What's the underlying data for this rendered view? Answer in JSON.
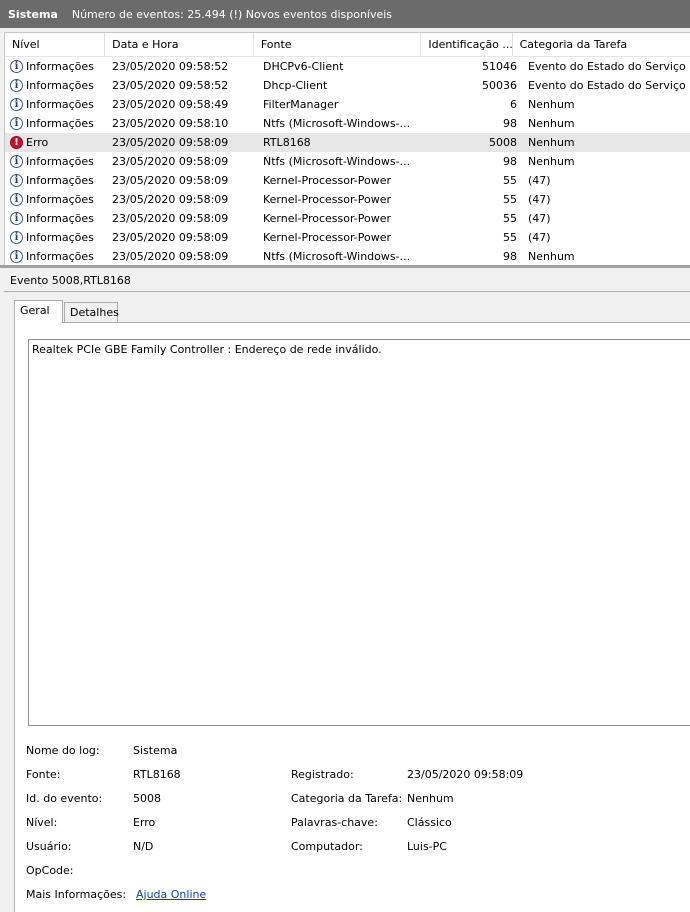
{
  "header": {
    "log_name": "Sistema",
    "summary": "Número de eventos: 25.494 (!) Novos eventos disponíveis"
  },
  "grid": {
    "columns": [
      "Nível",
      "Data e Hora",
      "Fonte",
      "Identificação ...",
      "Categoria da Tarefa"
    ],
    "rows": [
      {
        "level": "Informações",
        "icon": "info-icon",
        "datetime": "23/05/2020 09:58:52",
        "source": "DHCPv6-Client",
        "id": "51046",
        "category": "Evento do Estado do Serviço"
      },
      {
        "level": "Informações",
        "icon": "info-icon",
        "datetime": "23/05/2020 09:58:52",
        "source": "Dhcp-Client",
        "id": "50036",
        "category": "Evento do Estado do Serviço"
      },
      {
        "level": "Informações",
        "icon": "info-icon",
        "datetime": "23/05/2020 09:58:49",
        "source": "FilterManager",
        "id": "6",
        "category": "Nenhum"
      },
      {
        "level": "Informações",
        "icon": "info-icon",
        "datetime": "23/05/2020 09:58:10",
        "source": "Ntfs (Microsoft-Windows-...",
        "id": "98",
        "category": "Nenhum"
      },
      {
        "level": "Erro",
        "icon": "error-icon",
        "datetime": "23/05/2020 09:58:09",
        "source": "RTL8168",
        "id": "5008",
        "category": "Nenhum"
      },
      {
        "level": "Informações",
        "icon": "info-icon",
        "datetime": "23/05/2020 09:58:09",
        "source": "Ntfs (Microsoft-Windows-...",
        "id": "98",
        "category": "Nenhum"
      },
      {
        "level": "Informações",
        "icon": "info-icon",
        "datetime": "23/05/2020 09:58:09",
        "source": "Kernel-Processor-Power",
        "id": "55",
        "category": "(47)"
      },
      {
        "level": "Informações",
        "icon": "info-icon",
        "datetime": "23/05/2020 09:58:09",
        "source": "Kernel-Processor-Power",
        "id": "55",
        "category": "(47)"
      },
      {
        "level": "Informações",
        "icon": "info-icon",
        "datetime": "23/05/2020 09:58:09",
        "source": "Kernel-Processor-Power",
        "id": "55",
        "category": "(47)"
      },
      {
        "level": "Informações",
        "icon": "info-icon",
        "datetime": "23/05/2020 09:58:09",
        "source": "Kernel-Processor-Power",
        "id": "55",
        "category": "(47)"
      },
      {
        "level": "Informações",
        "icon": "info-icon",
        "datetime": "23/05/2020 09:58:09",
        "source": "Ntfs (Microsoft-Windows-...",
        "id": "98",
        "category": "Nenhum"
      }
    ]
  },
  "detail": {
    "title": "Evento 5008,RTL8168",
    "tabs": [
      "Geral",
      "Detalhes"
    ],
    "description": "Realtek PCIe GBE Family Controller : Endereço de rede inválido.",
    "props": {
      "log_label": "Nome do log:",
      "log_value": "Sistema",
      "source_label": "Fonte:",
      "source_value": "RTL8168",
      "logged_label": "Registrado:",
      "logged_value": "23/05/2020 09:58:09",
      "eventid_label": "Id. do evento:",
      "eventid_value": "5008",
      "category_label": "Categoria da Tarefa:",
      "category_value": "Nenhum",
      "level_label": "Nível:",
      "level_value": "Erro",
      "keywords_label": "Palavras-chave:",
      "keywords_value": "Clássico",
      "user_label": "Usuário:",
      "user_value": "N/D",
      "computer_label": "Computador:",
      "computer_value": "Luis-PC",
      "opcode_label": "OpCode:",
      "moreinfo_label": "Mais Informações:",
      "moreinfo_link": "Ajuda Online"
    }
  },
  "colors": {
    "title_bg": "#6b6b6b",
    "error_red": "#c8102e",
    "info_blue": "#1f3f77",
    "link": "#0645ad",
    "selected_row": "#e6e6e6"
  }
}
